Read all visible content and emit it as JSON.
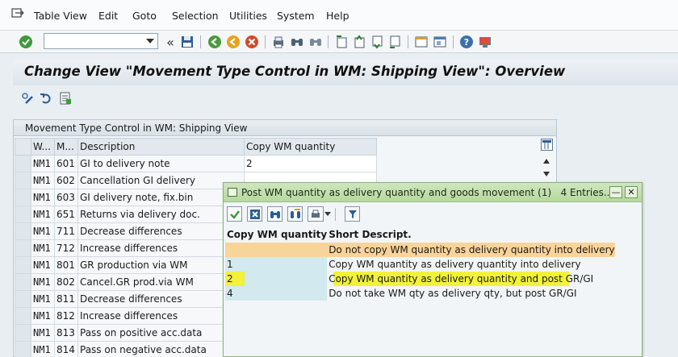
{
  "menu": {
    "items": [
      {
        "label": "Table View"
      },
      {
        "label": "Edit"
      },
      {
        "label": "Goto"
      },
      {
        "label": "Selection"
      },
      {
        "label": "Utilities"
      },
      {
        "label": "System"
      },
      {
        "label": "Help"
      }
    ]
  },
  "toolbar": {
    "command_field_value": ""
  },
  "title": "Change View \"Movement Type Control in WM: Shipping View\": Overview",
  "table": {
    "caption": "Movement Type Control in WM: Shipping View",
    "headers": [
      "W...",
      "M...",
      "Description",
      "Copy WM quantity"
    ],
    "rows": [
      {
        "wh": "NM1",
        "mvt": "601",
        "desc": "GI to delivery note",
        "copy": "2"
      },
      {
        "wh": "NM1",
        "mvt": "602",
        "desc": "Cancellation GI delivery",
        "copy": ""
      },
      {
        "wh": "NM1",
        "mvt": "603",
        "desc": "GI delivery note, fix.bin",
        "copy": ""
      },
      {
        "wh": "NM1",
        "mvt": "651",
        "desc": "Returns via delivery doc.",
        "copy": ""
      },
      {
        "wh": "NM1",
        "mvt": "711",
        "desc": "Decrease differences",
        "copy": ""
      },
      {
        "wh": "NM1",
        "mvt": "712",
        "desc": "Increase differences",
        "copy": ""
      },
      {
        "wh": "NM1",
        "mvt": "801",
        "desc": "GR production via WM",
        "copy": ""
      },
      {
        "wh": "NM1",
        "mvt": "802",
        "desc": "Cancel.GR prod.via WM",
        "copy": ""
      },
      {
        "wh": "NM1",
        "mvt": "811",
        "desc": "Decrease differences",
        "copy": ""
      },
      {
        "wh": "NM1",
        "mvt": "812",
        "desc": "Increase differences",
        "copy": ""
      },
      {
        "wh": "NM1",
        "mvt": "813",
        "desc": "Pass on positive acc.data",
        "copy": ""
      },
      {
        "wh": "NM1",
        "mvt": "814",
        "desc": "Pass on negative acc.data",
        "copy": ""
      }
    ]
  },
  "popup": {
    "title": "Post WM quantity as delivery quantity and goods movement (1)",
    "entries": "4 Entries...",
    "col_key": "Copy WM quantity",
    "col_desc": "Short Descript.",
    "rows": [
      {
        "key": "",
        "desc": "Do not copy WM quantity as delivery quantity into delivery"
      },
      {
        "key": "1",
        "desc": "Copy WM quantity as delivery quantity into delivery"
      },
      {
        "key": "2",
        "desc": "Copy WM quantity as delivery quantity and post GR/GI"
      },
      {
        "key": "4",
        "desc": "Do not take WM qty as delivery qty, but post GR/GI"
      }
    ]
  },
  "colors": {
    "popup_header_row": "#f9d49a",
    "highlight": "#f2f23a",
    "key_cell": "#d1e9ef"
  }
}
